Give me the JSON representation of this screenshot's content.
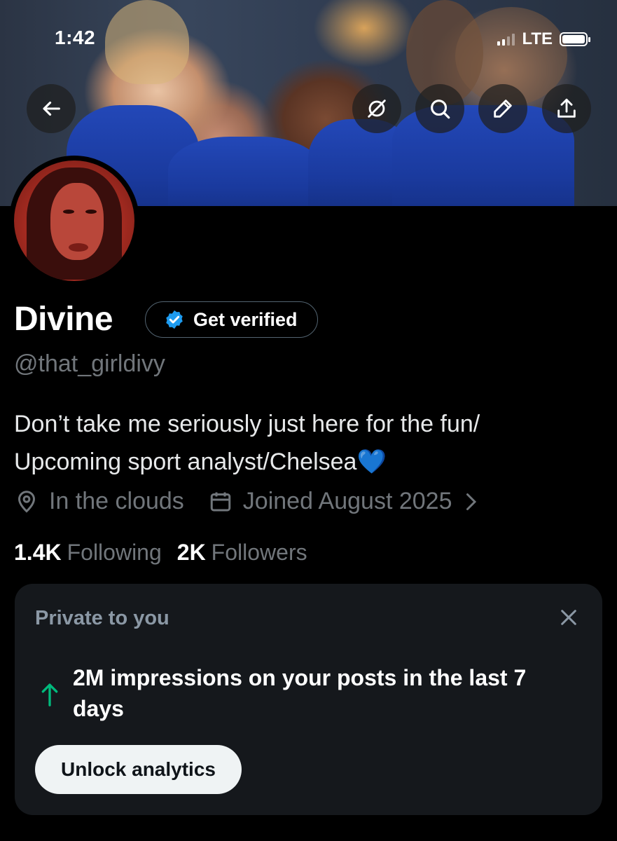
{
  "status_bar": {
    "time": "1:42",
    "network": "LTE"
  },
  "header": {
    "back_icon": "arrow-left-icon",
    "actions": [
      "mute-icon",
      "search-icon",
      "edit-icon",
      "share-icon"
    ]
  },
  "profile": {
    "display_name": "Divine",
    "verify_label": "Get verified",
    "handle": "@that_girldivy",
    "bio_line1": "Don’t take me seriously just here for the fun/",
    "bio_line2": "Upcoming sport analyst/Chelsea💙",
    "location": "In the clouds",
    "joined": "Joined August 2025",
    "following_count": "1.4K",
    "following_label": "Following",
    "followers_count": "2K",
    "followers_label": "Followers"
  },
  "private_card": {
    "title": "Private to you",
    "message": "2M impressions on your posts in the last 7 days",
    "button_label": "Unlock analytics"
  },
  "colors": {
    "background": "#000000",
    "muted_text": "#71767b",
    "verified_blue": "#1d9bf0",
    "up_arrow_green": "#00ba7c",
    "card_bg": "#15181c"
  }
}
